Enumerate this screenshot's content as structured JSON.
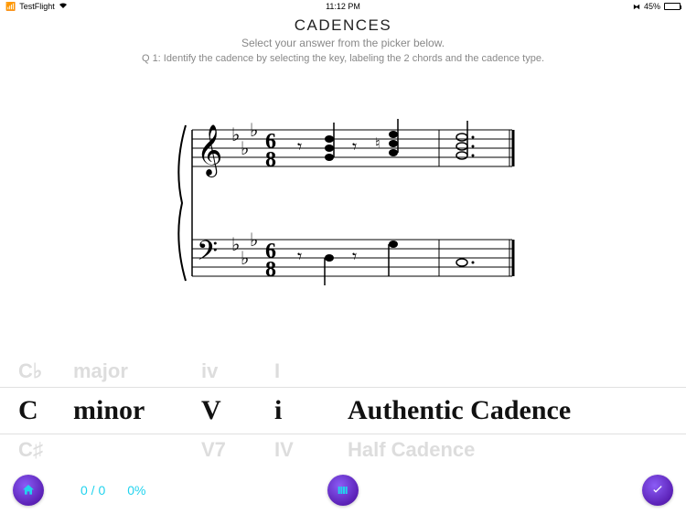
{
  "status": {
    "carrier": "TestFlight",
    "wifi": "wifi-icon",
    "time": "11:12 PM",
    "bluetooth": "bt-icon",
    "battery_pct": "45%"
  },
  "header": {
    "title": "CADENCES",
    "subtitle": "Select your answer from the picker below.",
    "question": "Q 1: Identify the cadence by selecting the key, labeling the 2 chords and the cadence type."
  },
  "picker": {
    "columns": [
      "key",
      "quality",
      "chord1",
      "chord2",
      "cadence"
    ],
    "above": {
      "key": "C♭",
      "quality": "major",
      "chord1": "iv",
      "chord2": "I",
      "cadence": ""
    },
    "selected": {
      "key": "C",
      "quality": "minor",
      "chord1": "V",
      "chord2": "i",
      "cadence": "Authentic Cadence"
    },
    "below": {
      "key": "C♯",
      "quality": "",
      "chord1": "V7",
      "chord2": "IV",
      "cadence": "Half Cadence"
    }
  },
  "bottom": {
    "score_done": "0 / 0",
    "score_pct": "0%"
  },
  "colors": {
    "accent_teal": "#22d3ee",
    "button_gradient_from": "#8b5cf6",
    "button_gradient_to": "#5b21b6"
  }
}
